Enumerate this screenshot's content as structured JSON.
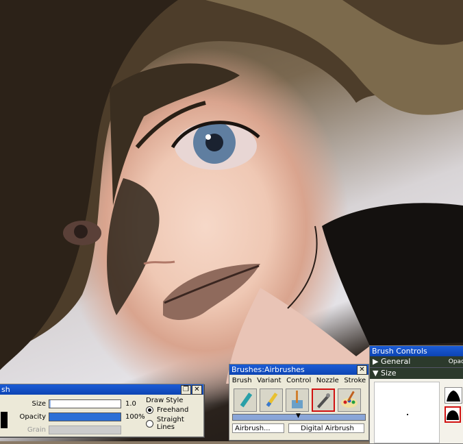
{
  "size_panel": {
    "title": "sh",
    "size_label": "Size",
    "size_value": "1.0",
    "size_fraction": 0.02,
    "opacity_label": "Opacity",
    "opacity_value": "100%",
    "opacity_fraction": 1.0,
    "grain_label": "Grain",
    "draw_style_label": "Draw Style",
    "freehand_label": "Freehand",
    "straight_lines_label": "Straight Lines",
    "selected_style": "Freehand"
  },
  "brushes_panel": {
    "title": "Brushes:Airbrushes",
    "tabs": [
      "Brush",
      "Variant",
      "Control",
      "Nozzle",
      "Stroke"
    ],
    "icons": [
      "marker-brush-icon",
      "pencil-brush-icon",
      "paintbrush-cup-icon",
      "airbrush-icon",
      "palette-icon"
    ],
    "selected_icon_index": 3,
    "category": "Airbrush...",
    "variant": "Digital Airbrush"
  },
  "brush_controls": {
    "title": "Brush Controls",
    "general_label": "General",
    "opacity_label": "Opac",
    "size_label": "Size"
  },
  "colors": {
    "titlebar": "#1b5cd6",
    "selection": "#d01010",
    "section_header": "#2c3a2c"
  }
}
